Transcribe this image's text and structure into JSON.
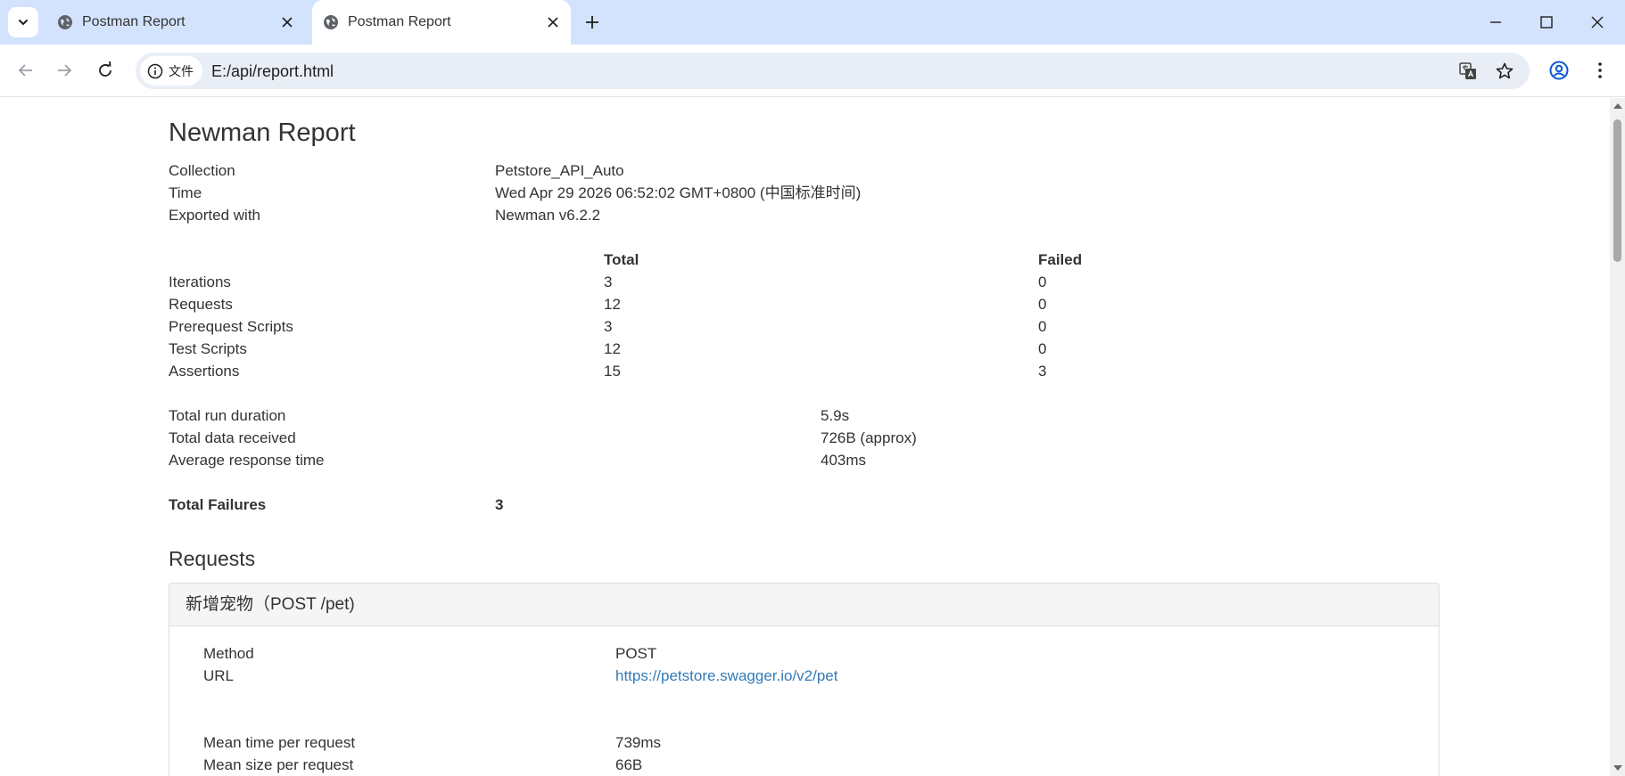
{
  "browser": {
    "tabs": [
      {
        "title": "Postman Report",
        "active": false
      },
      {
        "title": "Postman Report",
        "active": true
      }
    ],
    "site_info_label": "文件",
    "url": "E:/api/report.html"
  },
  "report": {
    "title": "Newman Report",
    "meta": [
      {
        "label": "Collection",
        "value": "Petstore_API_Auto"
      },
      {
        "label": "Time",
        "value": "Wed Apr 29 2026 06:52:02 GMT+0800 (中国标准时间)"
      },
      {
        "label": "Exported with",
        "value": "Newman v6.2.2"
      }
    ],
    "summary_headers": {
      "total": "Total",
      "failed": "Failed"
    },
    "summary": [
      {
        "label": "Iterations",
        "total": "3",
        "failed": "0"
      },
      {
        "label": "Requests",
        "total": "12",
        "failed": "0"
      },
      {
        "label": "Prerequest Scripts",
        "total": "3",
        "failed": "0"
      },
      {
        "label": "Test Scripts",
        "total": "12",
        "failed": "0"
      },
      {
        "label": "Assertions",
        "total": "15",
        "failed": "3"
      }
    ],
    "timings": [
      {
        "label": "Total run duration",
        "value": "5.9s"
      },
      {
        "label": "Total data received",
        "value": "726B (approx)"
      },
      {
        "label": "Average response time",
        "value": "403ms"
      }
    ],
    "total_failures": {
      "label": "Total Failures",
      "value": "3"
    },
    "requests_heading": "Requests",
    "request": {
      "title": "新增宠物（POST /pet)",
      "method_label": "Method",
      "method": "POST",
      "url_label": "URL",
      "url": "https://petstore.swagger.io/v2/pet",
      "mean_time_label": "Mean time per request",
      "mean_time": "739ms",
      "mean_size_label": "Mean size per request",
      "mean_size": "66B"
    }
  },
  "colors": {
    "chrome_frame": "#d3e3fd",
    "omnibox": "#e9eef6",
    "link": "#337ab7",
    "text": "#333333"
  },
  "icons": [
    "chevron-down-icon",
    "globe-icon",
    "close-icon",
    "plus-icon",
    "minimize-icon",
    "maximize-icon",
    "back-arrow-icon",
    "forward-arrow-icon",
    "reload-icon",
    "info-icon",
    "translate-icon",
    "star-icon",
    "profile-icon",
    "kebab-menu-icon"
  ]
}
